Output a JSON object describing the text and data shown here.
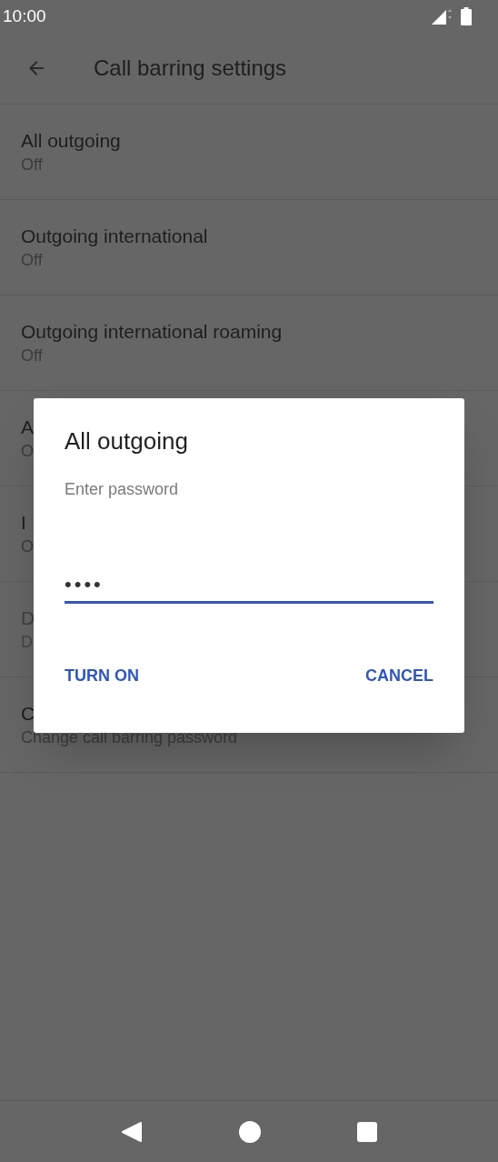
{
  "status_bar": {
    "time": "10:00"
  },
  "toolbar": {
    "title": "Call barring settings"
  },
  "items": [
    {
      "title": "All outgoing",
      "summary": "Off",
      "disabled": false
    },
    {
      "title": "Outgoing international",
      "summary": "Off",
      "disabled": false
    },
    {
      "title": "Outgoing international roaming",
      "summary": "Off",
      "disabled": false
    },
    {
      "title": "A",
      "summary": "O",
      "disabled": false
    },
    {
      "title": "I",
      "summary": "O",
      "disabled": false
    },
    {
      "title": "D",
      "summary": "D",
      "disabled": true
    },
    {
      "title": "C",
      "summary": "Change call barring password",
      "disabled": false
    }
  ],
  "dialog": {
    "title": "All outgoing",
    "message": "Enter password",
    "field": {
      "value": "••••",
      "focused": true
    },
    "buttons": [
      "TURN ON",
      "CANCEL"
    ]
  }
}
